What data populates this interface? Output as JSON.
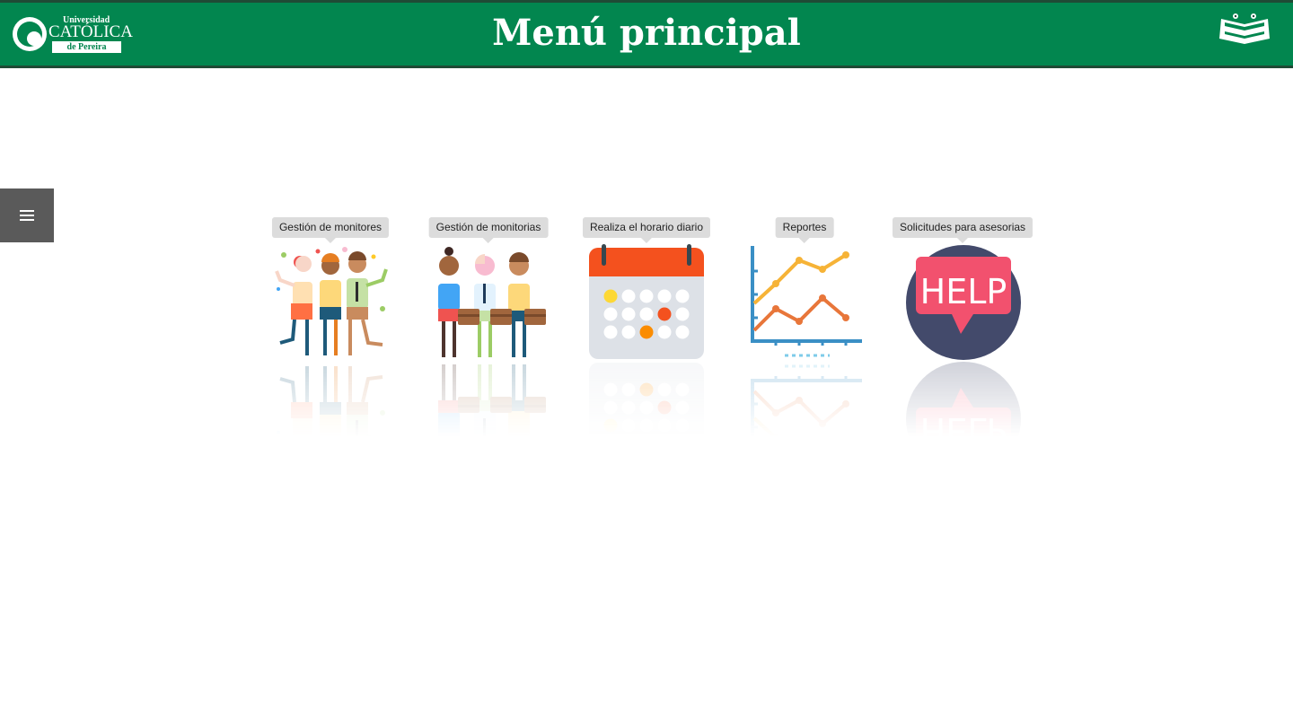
{
  "header": {
    "title": "Menú principal",
    "logo": {
      "line1": "Universidad",
      "line2": "CATÓLICA",
      "line3": "de Pereira"
    },
    "corner_logo_icon": "ucp-crest-icon"
  },
  "sidebar_toggle": {
    "icon": "hamburger-icon"
  },
  "menu": {
    "items": [
      {
        "label": "Gestión de monitores",
        "icon": "people-group-icon"
      },
      {
        "label": "Gestión de monitorias",
        "icon": "business-people-icon"
      },
      {
        "label": "Realiza el horario diario",
        "icon": "calendar-icon"
      },
      {
        "label": "Reportes",
        "icon": "line-chart-icon"
      },
      {
        "label": "Solicitudes para asesorias",
        "icon": "help-icon",
        "icon_text": "HELP"
      }
    ]
  },
  "colors": {
    "header_bg": "#02864f",
    "toggle_bg": "#5a5a5a",
    "tooltip_bg": "#dcdcdc"
  }
}
